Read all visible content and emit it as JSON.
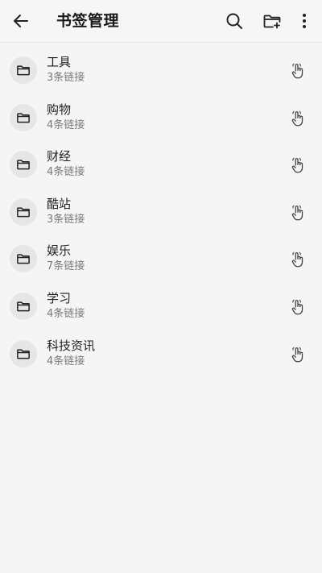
{
  "toolbar": {
    "title": "书签管理",
    "back_icon": "arrow-left-icon",
    "search_icon": "search-icon",
    "new_folder_icon": "folder-plus-icon",
    "more_icon": "more-vertical-icon"
  },
  "folders": [
    {
      "name": "工具",
      "count": "3条链接"
    },
    {
      "name": "购物",
      "count": "4条链接"
    },
    {
      "name": "财经",
      "count": "4条链接"
    },
    {
      "name": "酷站",
      "count": "3条链接"
    },
    {
      "name": "娱乐",
      "count": "7条链接"
    },
    {
      "name": "学习",
      "count": "4条链接"
    },
    {
      "name": "科技资讯",
      "count": "4条链接"
    }
  ],
  "colors": {
    "background": "#f5f5f5",
    "folder_circle": "#e6e6e6",
    "primary_text": "#1f1f1f",
    "secondary_text": "#7a7a7a"
  }
}
